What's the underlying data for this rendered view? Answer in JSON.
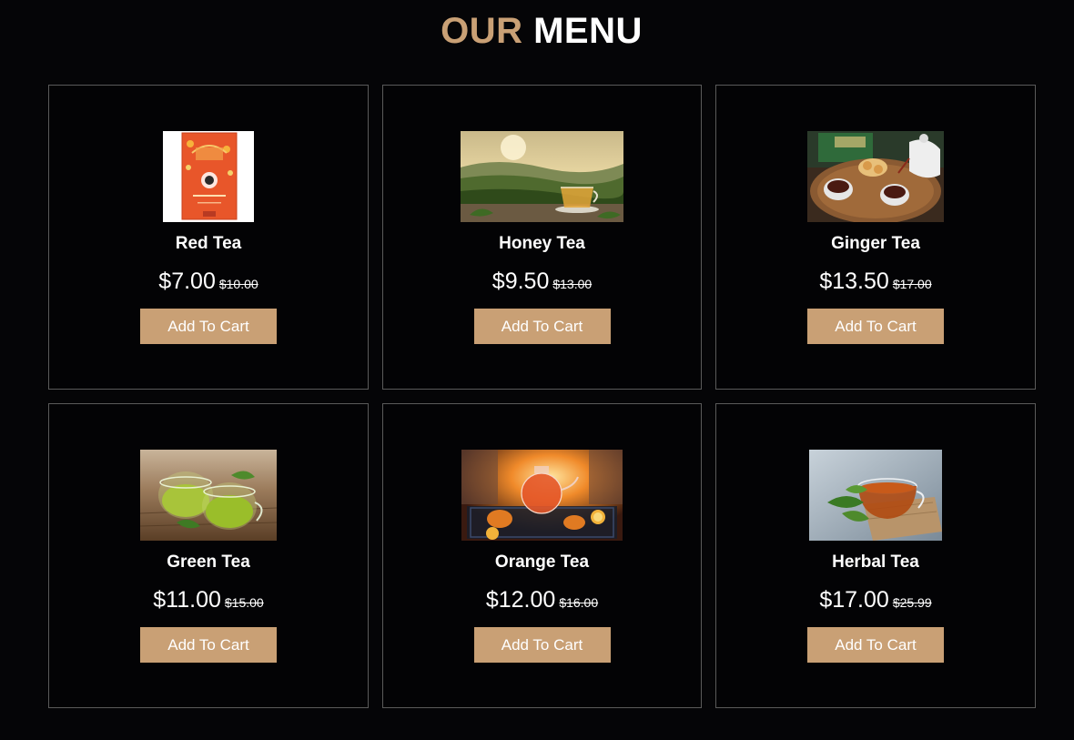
{
  "heading": {
    "accent": "OUR",
    "rest": "MENU"
  },
  "colors": {
    "accent": "#c9a075",
    "background": "#050507",
    "card_border": "#5a5a5a"
  },
  "products": [
    {
      "name": "Red Tea",
      "price": "$7.00",
      "old_price": "$10.00",
      "button": "Add To Cart",
      "image": "red-tea-box-image"
    },
    {
      "name": "Honey Tea",
      "price": "$9.50",
      "old_price": "$13.00",
      "button": "Add To Cart",
      "image": "tea-plantation-cup-image"
    },
    {
      "name": "Ginger Tea",
      "price": "$13.50",
      "old_price": "$17.00",
      "button": "Add To Cart",
      "image": "tea-tray-cups-image"
    },
    {
      "name": "Green Tea",
      "price": "$11.00",
      "old_price": "$15.00",
      "button": "Add To Cart",
      "image": "green-tea-cups-image"
    },
    {
      "name": "Orange Tea",
      "price": "$12.00",
      "old_price": "$16.00",
      "button": "Add To Cart",
      "image": "orange-teapot-fireplace-image"
    },
    {
      "name": "Herbal Tea",
      "price": "$17.00",
      "old_price": "$25.99",
      "button": "Add To Cart",
      "image": "herbal-tea-cup-image"
    }
  ]
}
